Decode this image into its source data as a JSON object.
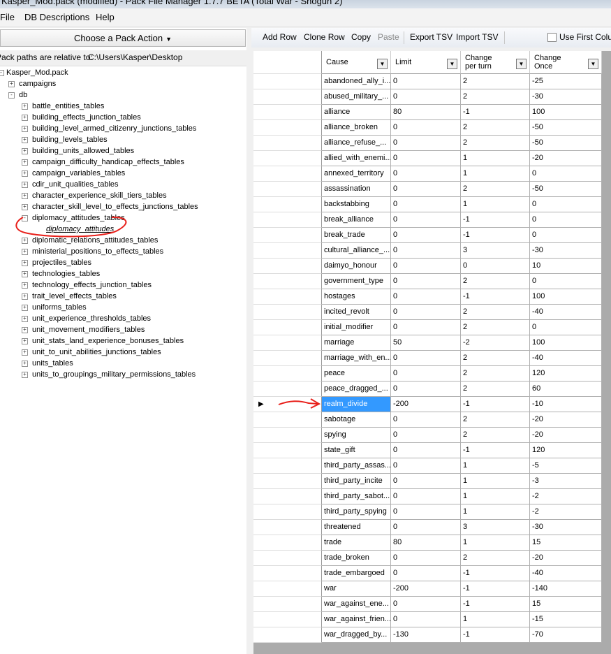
{
  "window": {
    "title": "Kasper_Mod.pack (modified) - Pack File Manager 1.7.7 BETA (Total War - Shogun 2)"
  },
  "menu": {
    "file": "File",
    "db_descriptions": "DB Descriptions",
    "help": "Help"
  },
  "left": {
    "action_button": "Choose a Pack Action",
    "paths_label": "Pack paths are relative to:",
    "paths_value": "C:\\Users\\Kasper\\Desktop"
  },
  "tree": {
    "root": "Kasper_Mod.pack",
    "campaigns": "campaigns",
    "db": "db",
    "tables": [
      "battle_entities_tables",
      "building_effects_junction_tables",
      "building_level_armed_citizenry_junctions_tables",
      "building_levels_tables",
      "building_units_allowed_tables",
      "campaign_difficulty_handicap_effects_tables",
      "campaign_variables_tables",
      "cdir_unit_qualities_tables",
      "character_experience_skill_tiers_tables",
      "character_skill_level_to_effects_junctions_tables",
      "diplomacy_attitudes_tables",
      "diplomatic_relations_attitudes_tables",
      "ministerial_positions_to_effects_tables",
      "projectiles_tables",
      "technologies_tables",
      "technology_effects_junction_tables",
      "trait_level_effects_tables",
      "uniforms_tables",
      "unit_experience_thresholds_tables",
      "unit_movement_modifiers_tables",
      "unit_stats_land_experience_bonuses_tables",
      "unit_to_unit_abilities_junctions_tables",
      "units_tables",
      "units_to_groupings_military_permissions_tables"
    ],
    "open_file": "diplomacy_attitudes"
  },
  "toolbar": {
    "add_row": "Add Row",
    "clone_row": "Clone Row",
    "copy": "Copy",
    "paste": "Paste",
    "export_tsv": "Export TSV",
    "import_tsv": "Import TSV",
    "first_column": "Use First Colum"
  },
  "grid": {
    "headers": [
      "Cause",
      "Limit",
      "Change\nper turn",
      "Change\nOnce"
    ],
    "rows": [
      [
        "abandoned_ally_i...",
        "0",
        "2",
        "-25"
      ],
      [
        "abused_military_...",
        "0",
        "2",
        "-30"
      ],
      [
        "alliance",
        "80",
        "-1",
        "100"
      ],
      [
        "alliance_broken",
        "0",
        "2",
        "-50"
      ],
      [
        "alliance_refuse_...",
        "0",
        "2",
        "-50"
      ],
      [
        "allied_with_enemi...",
        "0",
        "1",
        "-20"
      ],
      [
        "annexed_territory",
        "0",
        "1",
        "0"
      ],
      [
        "assassination",
        "0",
        "2",
        "-50"
      ],
      [
        "backstabbing",
        "0",
        "1",
        "0"
      ],
      [
        "break_alliance",
        "0",
        "-1",
        "0"
      ],
      [
        "break_trade",
        "0",
        "-1",
        "0"
      ],
      [
        "cultural_alliance_...",
        "0",
        "3",
        "-30"
      ],
      [
        "daimyo_honour",
        "0",
        "0",
        "10"
      ],
      [
        "government_type",
        "0",
        "2",
        "0"
      ],
      [
        "hostages",
        "0",
        "-1",
        "100"
      ],
      [
        "incited_revolt",
        "0",
        "2",
        "-40"
      ],
      [
        "initial_modifier",
        "0",
        "2",
        "0"
      ],
      [
        "marriage",
        "50",
        "-2",
        "100"
      ],
      [
        "marriage_with_en...",
        "0",
        "2",
        "-40"
      ],
      [
        "peace",
        "0",
        "2",
        "120"
      ],
      [
        "peace_dragged_...",
        "0",
        "2",
        "60"
      ],
      [
        "realm_divide",
        "-200",
        "-1",
        "-10"
      ],
      [
        "sabotage",
        "0",
        "2",
        "-20"
      ],
      [
        "spying",
        "0",
        "2",
        "-20"
      ],
      [
        "state_gift",
        "0",
        "-1",
        "120"
      ],
      [
        "third_party_assas...",
        "0",
        "1",
        "-5"
      ],
      [
        "third_party_incite",
        "0",
        "1",
        "-3"
      ],
      [
        "third_party_sabot...",
        "0",
        "1",
        "-2"
      ],
      [
        "third_party_spying",
        "0",
        "1",
        "-2"
      ],
      [
        "threatened",
        "0",
        "3",
        "-30"
      ],
      [
        "trade",
        "80",
        "1",
        "15"
      ],
      [
        "trade_broken",
        "0",
        "2",
        "-20"
      ],
      [
        "trade_embargoed",
        "0",
        "-1",
        "-40"
      ],
      [
        "war",
        "-200",
        "-1",
        "-140"
      ],
      [
        "war_against_ene...",
        "0",
        "-1",
        "15"
      ],
      [
        "war_against_frien...",
        "0",
        "1",
        "-15"
      ],
      [
        "war_dragged_by...",
        "-130",
        "-1",
        "-70"
      ]
    ],
    "selected_row": 21
  },
  "colors": {
    "selection": "#3399ff",
    "annotation": "#e8201b"
  }
}
